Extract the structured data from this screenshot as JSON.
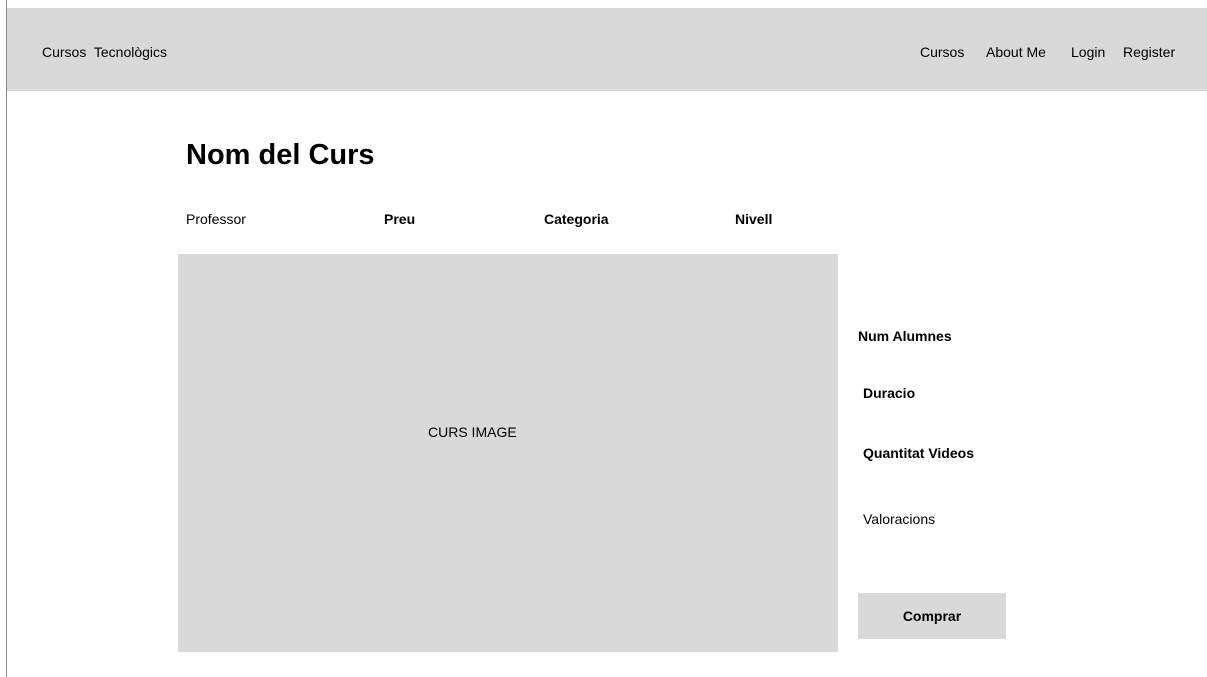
{
  "header": {
    "brand": "Cursos  Tecnològics",
    "nav": [
      "Cursos",
      "About Me",
      "Login",
      "Register"
    ]
  },
  "course": {
    "title": "Nom del Curs",
    "professor": "Professor",
    "price": "Preu",
    "category": "Categoria",
    "level": "Nivell",
    "image_label": "CURS IMAGE"
  },
  "stats": {
    "students": "Num Alumnes",
    "duration": "Duracio",
    "videos": "Quantitat Videos",
    "ratings": "Valoracions"
  },
  "actions": {
    "buy": "Comprar"
  },
  "colors": {
    "panel": "#d9d9d9",
    "text": "#000000",
    "background": "#ffffff"
  }
}
